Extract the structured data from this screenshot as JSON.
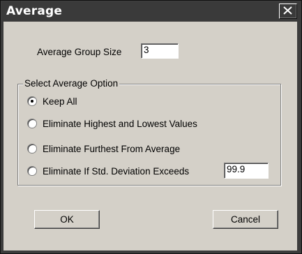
{
  "window": {
    "title": "Average"
  },
  "group_size": {
    "label": "Average Group Size",
    "value": "3"
  },
  "options": {
    "legend": "Select Average Option",
    "items": [
      {
        "label": "Keep All",
        "checked": true
      },
      {
        "label": "Eliminate Highest and Lowest Values",
        "checked": false
      },
      {
        "label": "Eliminate Furthest From Average",
        "checked": false
      },
      {
        "label": "Eliminate If Std. Deviation Exceeds",
        "checked": false
      }
    ],
    "std_dev_value": "99.9"
  },
  "buttons": {
    "ok": "OK",
    "cancel": "Cancel"
  }
}
